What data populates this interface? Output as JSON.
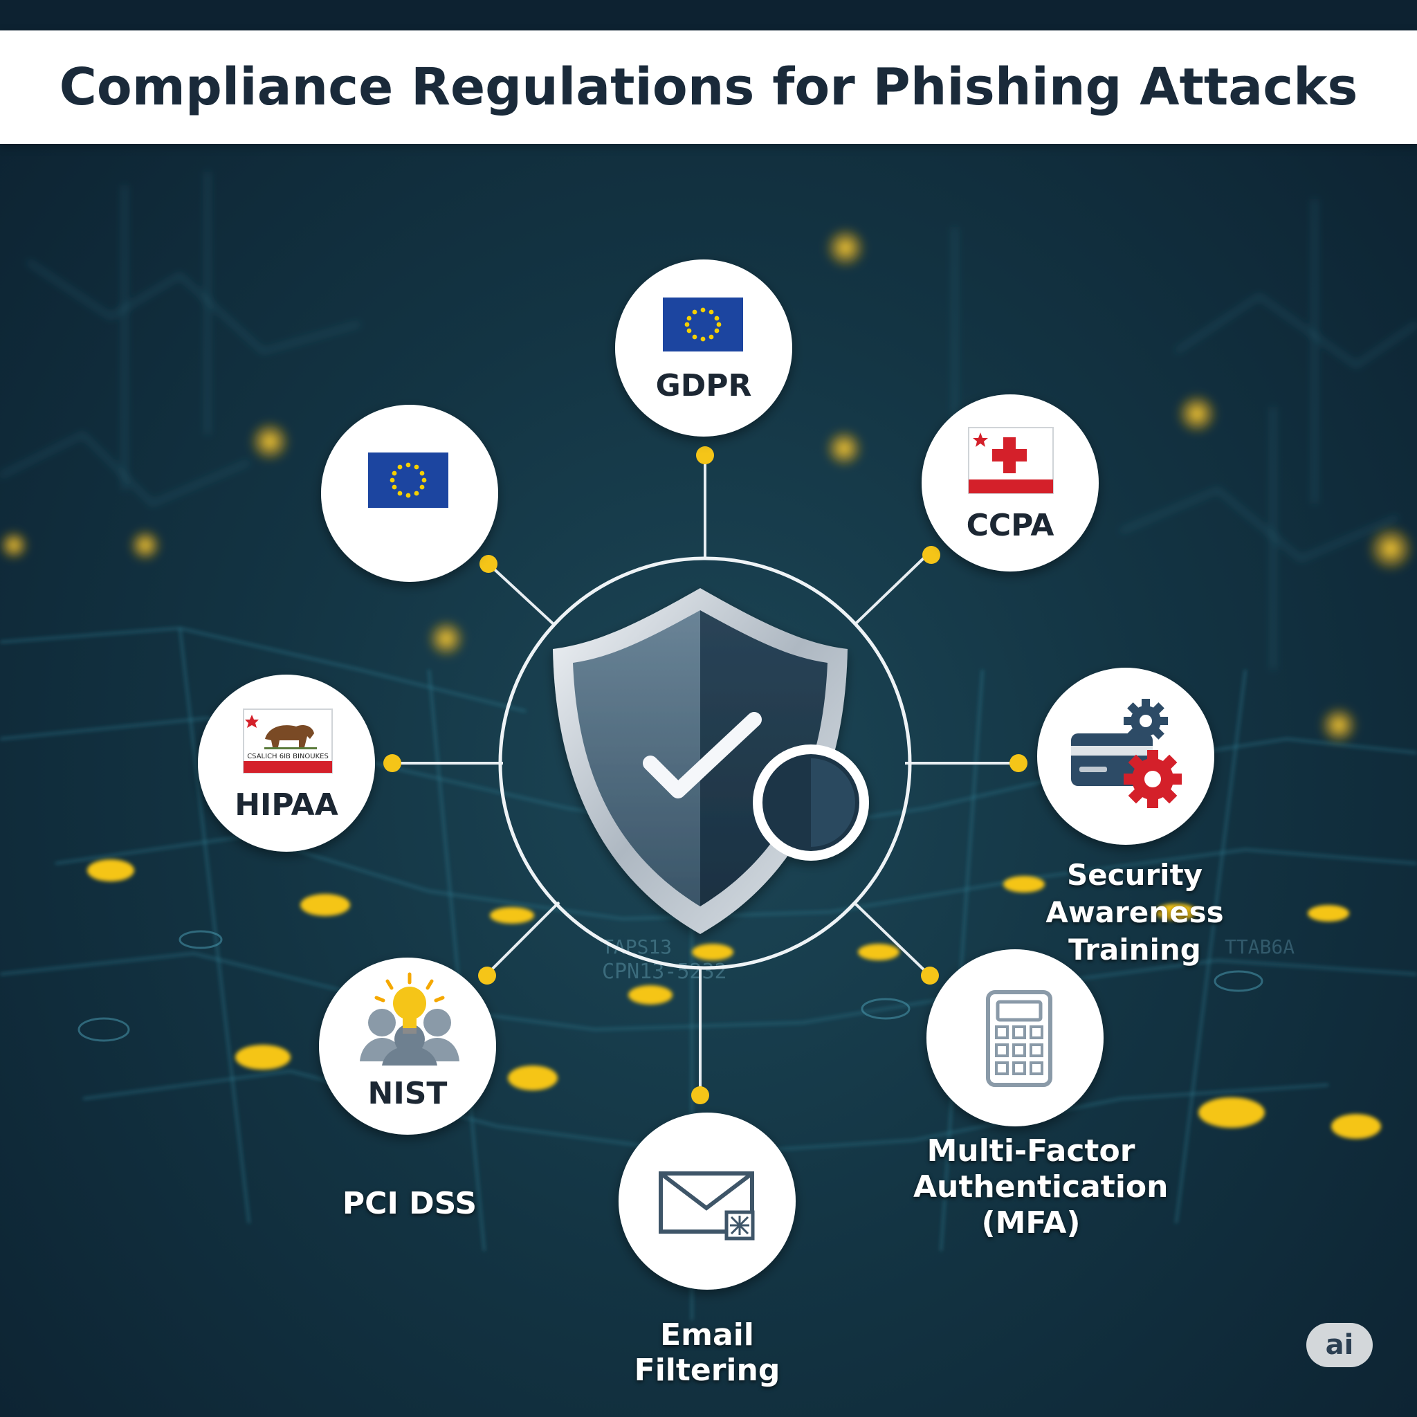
{
  "title": "Compliance Regulations for Phishing Attacks",
  "nodes": {
    "gdpr": {
      "label": "GDPR",
      "icon": "eu-flag-icon"
    },
    "eu": {
      "label": "",
      "icon": "eu-flag-icon"
    },
    "ccpa": {
      "label": "CCPA",
      "icon": "red-cross-flag-icon"
    },
    "hipaa": {
      "label": "HIPAA",
      "icon": "california-flag-icon",
      "flag_text": "CSALICH 6IB BINOUKES"
    },
    "security_awareness": {
      "label": "Security Awareness Training",
      "icon": "card-gear-icon"
    },
    "nist": {
      "label": "NIST",
      "icon": "lightbulb-people-icon"
    },
    "pci_dss": {
      "label": "PCI DSS"
    },
    "mfa": {
      "label": "Multi-Factor Authentication (MFA)",
      "icon": "calculator-icon"
    },
    "email": {
      "label": "Email Filtering",
      "icon": "envelope-icon"
    }
  },
  "center": {
    "icon": "shield-check-magnifier-icon"
  },
  "background_text": [
    "TAPS13",
    "CPN13-5232",
    "TTAB6A"
  ],
  "badge": "ai",
  "colors": {
    "background": "#133443",
    "accent": "#f5c518",
    "node_bg": "#ffffff",
    "title_text": "#1a2a3a",
    "eu_blue": "#1c45a0",
    "red": "#d4202a"
  }
}
